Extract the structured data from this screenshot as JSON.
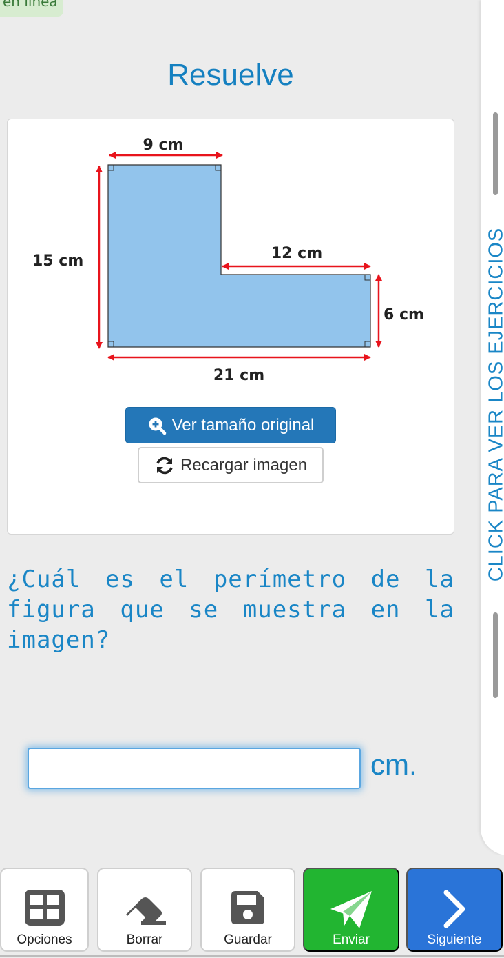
{
  "top_badge": "en línea",
  "title": "Resuelve",
  "figure": {
    "labels": {
      "top": "9 cm",
      "left": "15 cm",
      "inner": "12 cm",
      "right": "6 cm",
      "bottom": "21 cm"
    },
    "fill_color": "#92c4ec",
    "arrow_color": "#e8141c"
  },
  "buttons": {
    "view_original": "Ver tamaño original",
    "reload_image": "Recargar imagen"
  },
  "question": "¿Cuál es el perímetro de la figura que se muestra en la imagen?",
  "answer": {
    "value": "",
    "unit": "cm."
  },
  "side_panel": {
    "label": "CLICK PARA VER LOS EJERCICIOS"
  },
  "footer": {
    "options": "Opciones",
    "erase": "Borrar",
    "save": "Guardar",
    "send": "Enviar",
    "next": "Siguiente"
  },
  "colors": {
    "accent": "#1a86c6",
    "send": "#22b531",
    "next": "#2a74d8",
    "primary_button": "#2477b8"
  }
}
